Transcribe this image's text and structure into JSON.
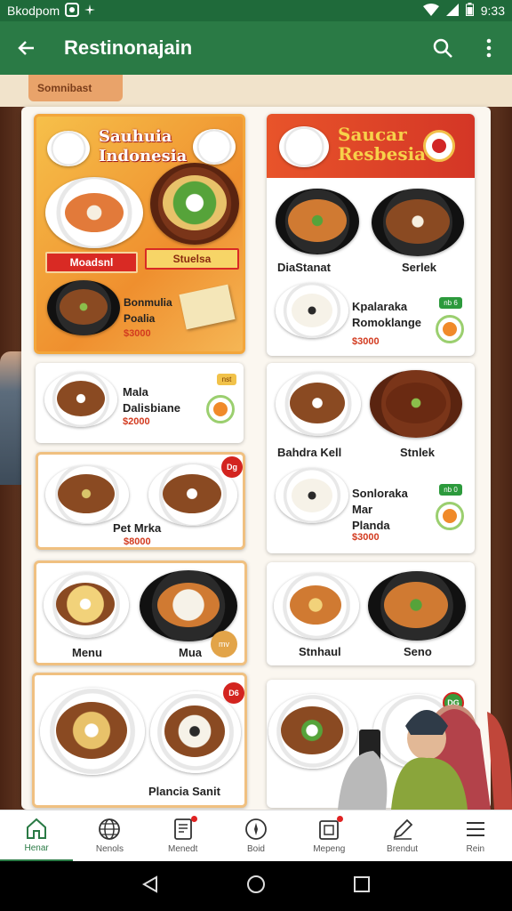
{
  "status_bar": {
    "carrier": "Bkodpom",
    "time": "9:33"
  },
  "app_bar": {
    "title": "Restinonajain"
  },
  "header_chip": "Somnibast",
  "promo": {
    "title_line1": "Sauhuia",
    "title_line2": "Indonesia",
    "btn_red": "Moadsnl",
    "btn_yellow": "Stuelsa",
    "dish_name_1": "Bonmulia",
    "dish_name_2": "Poalia",
    "price": "$3000"
  },
  "featured": {
    "title_line1": "Saucar",
    "title_line2": "Resbesia",
    "dish_a": "DiaStanat",
    "dish_b": "Serlek",
    "item_name_1": "Kpalaraka",
    "item_name_2": "Romoklange",
    "price": "$3000",
    "badge": "nb 6"
  },
  "left_cards": [
    {
      "name_1": "Mala",
      "name_2": "Dalisbiane",
      "price": "$2000",
      "badge": "nst"
    },
    {
      "name": "Pet Mrka",
      "price": "$8000",
      "badge": "Dg"
    },
    {
      "name_a": "Menu",
      "name_b": "Mua",
      "badge": "mv"
    },
    {
      "name": "Plancia Sanit",
      "badge": "D6"
    }
  ],
  "right_cards": [
    {
      "name_a": "Bahdra Kell",
      "name_b": "Stnlek",
      "item_1": "Sonloraka",
      "item_2": "Mar",
      "item_3": "Planda",
      "price": "$3000",
      "badge": "nb 0"
    },
    {
      "name_a": "Stnhaul",
      "name_b": "Seno"
    },
    {
      "badge": "DG"
    }
  ],
  "bottom_nav": [
    {
      "label": "Henar",
      "icon": "home-icon",
      "active": true
    },
    {
      "label": "Nenols",
      "icon": "globe-icon",
      "active": false
    },
    {
      "label": "Menedt",
      "icon": "receipt-icon",
      "active": false
    },
    {
      "label": "Boid",
      "icon": "compass-icon",
      "active": false
    },
    {
      "label": "Mepeng",
      "icon": "calendar-icon",
      "active": false
    },
    {
      "label": "Brendut",
      "icon": "edit-icon",
      "active": false
    },
    {
      "label": "Rein",
      "icon": "menu-icon",
      "active": false
    }
  ],
  "colors": {
    "primary": "#2a7a45",
    "accent_red": "#d92a24",
    "accent_orange": "#ef8f2e"
  }
}
